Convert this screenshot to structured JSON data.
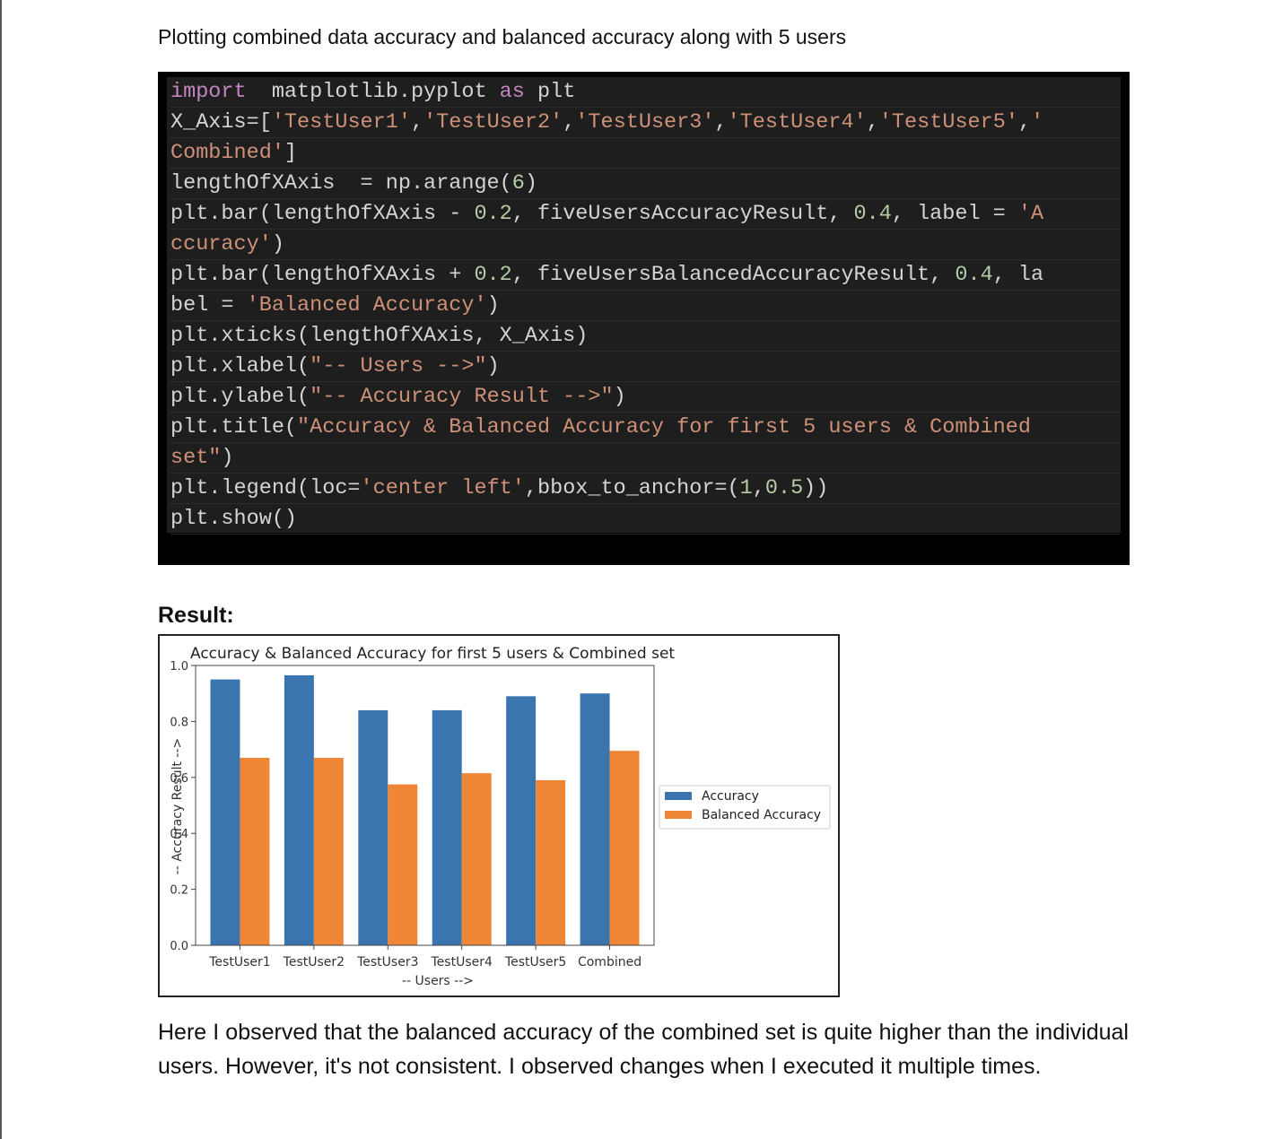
{
  "heading": "Plotting combined data accuracy and balanced accuracy along with 5 users",
  "code_lines": [
    [
      [
        "kw",
        "import"
      ],
      [
        "",
        "  matplotlib.pyplot "
      ],
      [
        "kw",
        "as"
      ],
      [
        "",
        " plt"
      ]
    ],
    [
      [
        "",
        "X_Axis=["
      ],
      [
        "str",
        "'TestUser1'"
      ],
      [
        "",
        ","
      ],
      [
        "str",
        "'TestUser2'"
      ],
      [
        "",
        ","
      ],
      [
        "str",
        "'TestUser3'"
      ],
      [
        "",
        ","
      ],
      [
        "str",
        "'TestUser4'"
      ],
      [
        "",
        ","
      ],
      [
        "str",
        "'TestUser5'"
      ],
      [
        "",
        ","
      ],
      [
        "str",
        "'"
      ]
    ],
    [
      [
        "str",
        "Combined'"
      ],
      [
        "",
        "]"
      ]
    ],
    [
      [
        "",
        "lengthOfXAxis  = np.arange("
      ],
      [
        "num",
        "6"
      ],
      [
        "",
        ")"
      ]
    ],
    [
      [
        "",
        "plt.bar(lengthOfXAxis - "
      ],
      [
        "num",
        "0.2"
      ],
      [
        "",
        ", fiveUsersAccuracyResult, "
      ],
      [
        "num",
        "0.4"
      ],
      [
        "",
        ", label = "
      ],
      [
        "str",
        "'A"
      ]
    ],
    [
      [
        "str",
        "ccuracy'"
      ],
      [
        "",
        ")"
      ]
    ],
    [
      [
        "",
        "plt.bar(lengthOfXAxis + "
      ],
      [
        "num",
        "0.2"
      ],
      [
        "",
        ", fiveUsersBalancedAccuracyResult, "
      ],
      [
        "num",
        "0.4"
      ],
      [
        "",
        ", la"
      ]
    ],
    [
      [
        "",
        "bel = "
      ],
      [
        "str",
        "'Balanced Accuracy'"
      ],
      [
        "",
        ")"
      ]
    ],
    [
      [
        "",
        "plt.xticks(lengthOfXAxis, X_Axis)"
      ]
    ],
    [
      [
        "",
        "plt.xlabel("
      ],
      [
        "str",
        "\"-- Users -->\""
      ],
      [
        "",
        ")"
      ]
    ],
    [
      [
        "",
        "plt.ylabel("
      ],
      [
        "str",
        "\"-- Accuracy Result -->\""
      ],
      [
        "",
        ")"
      ]
    ],
    [
      [
        "",
        "plt.title("
      ],
      [
        "str",
        "\"Accuracy & Balanced Accuracy for first 5 users & Combined"
      ]
    ],
    [
      [
        "str",
        "set\""
      ],
      [
        "",
        ")"
      ]
    ],
    [
      [
        "",
        "plt.legend(loc="
      ],
      [
        "str",
        "'center left'"
      ],
      [
        "",
        ",bbox_to_anchor=("
      ],
      [
        "num",
        "1"
      ],
      [
        "",
        ","
      ],
      [
        "num",
        "0.5"
      ],
      [
        "",
        "))"
      ]
    ],
    [
      [
        "",
        "plt.show()"
      ]
    ]
  ],
  "result_label": "Result:",
  "chart_data": {
    "type": "bar",
    "title": "Accuracy & Balanced Accuracy for first 5 users & Combined set",
    "xlabel": "-- Users -->",
    "ylabel": "-- Accuracy Result -->",
    "categories": [
      "TestUser1",
      "TestUser2",
      "TestUser3",
      "TestUser4",
      "TestUser5",
      "Combined"
    ],
    "series": [
      {
        "name": "Accuracy",
        "color": "#3a75b0",
        "values": [
          0.95,
          0.965,
          0.84,
          0.84,
          0.89,
          0.9
        ]
      },
      {
        "name": "Balanced Accuracy",
        "color": "#ef8636",
        "values": [
          0.67,
          0.67,
          0.575,
          0.615,
          0.59,
          0.695
        ]
      }
    ],
    "ylim": [
      0,
      1.0
    ],
    "yticks": [
      "0.0",
      "0.2",
      "0.4",
      "0.6",
      "0.8",
      "1.0"
    ],
    "grid": false,
    "legend_placement": "center-right-outside"
  },
  "paragraph": "Here I observed that the balanced accuracy of the combined set is quite higher than the individual users. However, it's not consistent. I observed changes when I executed it multiple times."
}
